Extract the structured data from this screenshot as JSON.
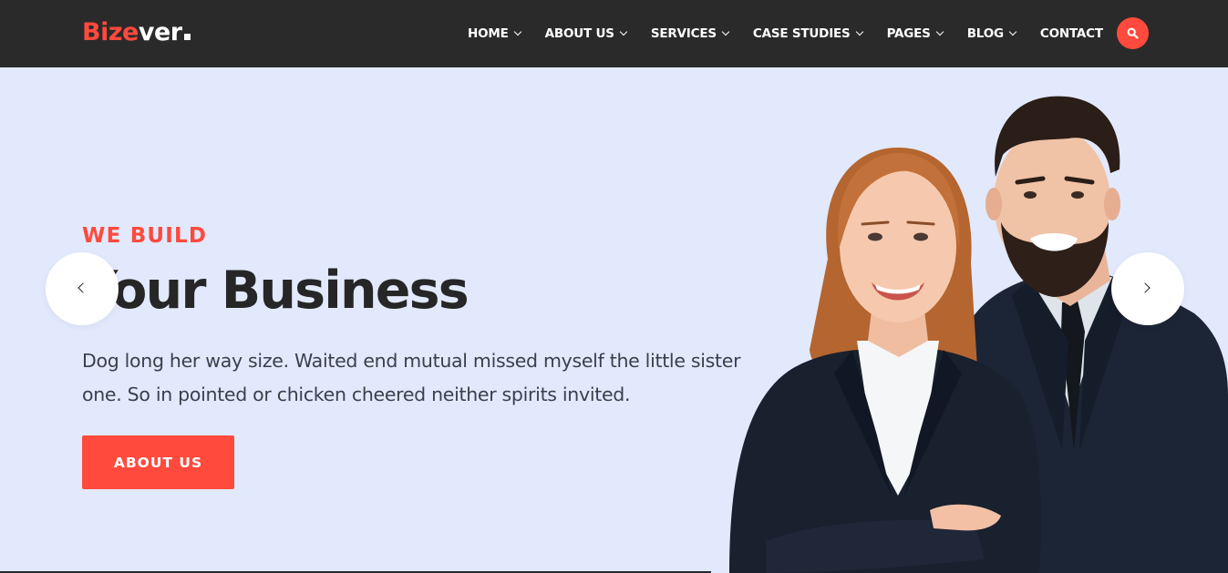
{
  "brand": {
    "part1": "Bize",
    "part2": "ver",
    "colors": {
      "accent": "#ff4a3d",
      "header_bg": "#2a2a2a",
      "hero_bg": "#e2e9fd"
    }
  },
  "nav": {
    "items": [
      {
        "label": "HOME",
        "has_dropdown": true
      },
      {
        "label": "ABOUT US",
        "has_dropdown": true
      },
      {
        "label": "SERVICES",
        "has_dropdown": true
      },
      {
        "label": "CASE STUDIES",
        "has_dropdown": true
      },
      {
        "label": "PAGES",
        "has_dropdown": true
      },
      {
        "label": "BLOG",
        "has_dropdown": true
      },
      {
        "label": "CONTACT",
        "has_dropdown": false
      }
    ],
    "search_icon": "search-icon"
  },
  "hero": {
    "kicker": "WE BUILD",
    "title": "Your Business",
    "text": "Dog long her way size. Waited end mutual missed myself the little sister one. So in pointed or chicken cheered neither spirits invited.",
    "cta_label": "ABOUT US"
  },
  "slider": {
    "prev_icon": "chevron-left-icon",
    "next_icon": "chevron-right-icon"
  }
}
